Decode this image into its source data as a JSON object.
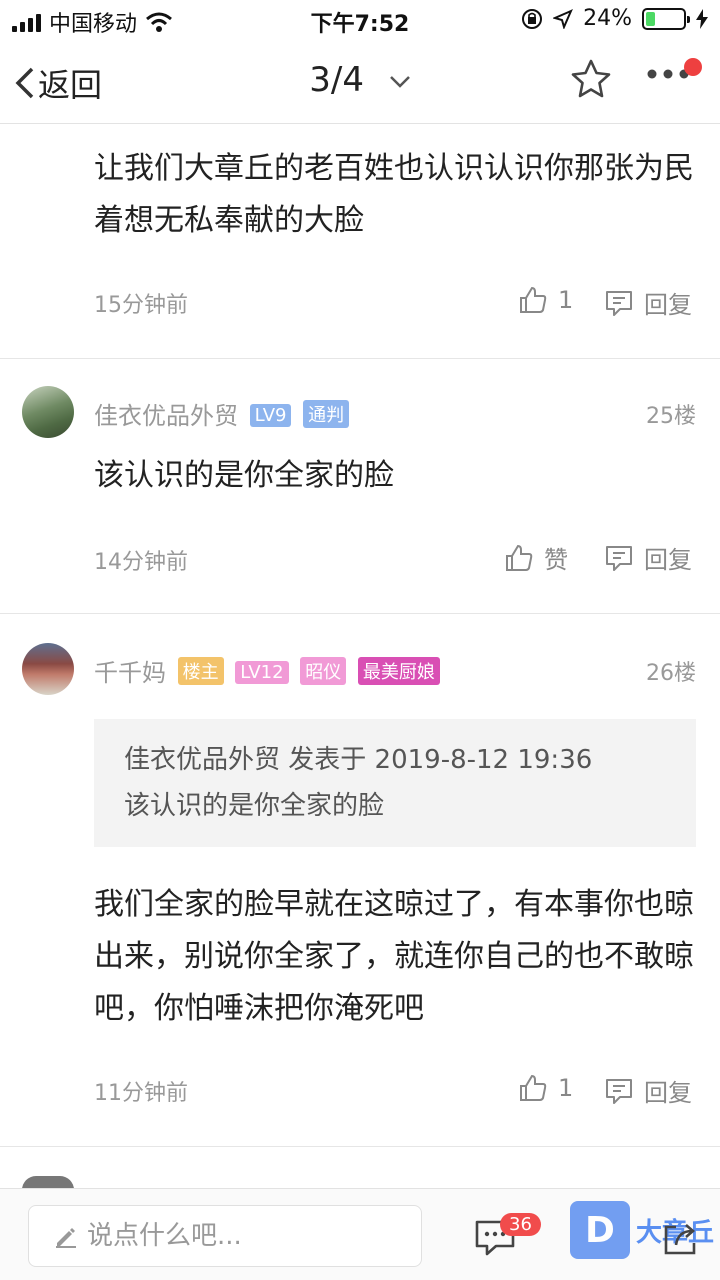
{
  "status_bar": {
    "carrier": "中国移动",
    "time": "下午7:52",
    "battery": "24%",
    "battery_level": 0.24
  },
  "nav": {
    "back_label": "返回",
    "page_indicator": "3/4"
  },
  "comments": [
    {
      "text": "让我们大章丘的老百姓也认识认识你那张为民着想无私奉献的大脸",
      "time": "15分钟前",
      "likes": "1",
      "reply_label": "回复"
    },
    {
      "user": "佳衣优品外贸",
      "badges": [
        "LV9",
        "通判"
      ],
      "floor": "25楼",
      "text": "该认识的是你全家的脸",
      "time": "14分钟前",
      "like_label": "赞",
      "reply_label": "回复"
    },
    {
      "user": "千千妈",
      "badges": [
        "楼主",
        "LV12",
        "昭仪",
        "最美厨娘"
      ],
      "floor": "26楼",
      "quote_header": "佳衣优品外贸 发表于 2019-8-12 19:36",
      "quote_text": "该认识的是你全家的脸",
      "text": "我们全家的脸早就在这晾过了，有本事你也晾出来，别说你全家了，就连你自己的也不敢晾吧，你怕唾沫把你淹死吧",
      "time": "11分钟前",
      "likes": "1",
      "reply_label": "回复"
    }
  ],
  "bottom_bar": {
    "input_placeholder": "说点什么吧...",
    "comment_count": "36"
  },
  "watermark": {
    "text": "大章丘",
    "logo_letter": "D"
  },
  "colors": {
    "accent_blue": "#5b8ff0",
    "badge_lv9": "#8db4ee",
    "badge_tongpan": "#8db4ee",
    "badge_louzhu": "#f3c36a",
    "badge_lv12": "#f19ad6",
    "badge_zhaoyi": "#f19ad6",
    "badge_chuniang": "#d94fb4",
    "red_badge": "#f14c4c"
  }
}
